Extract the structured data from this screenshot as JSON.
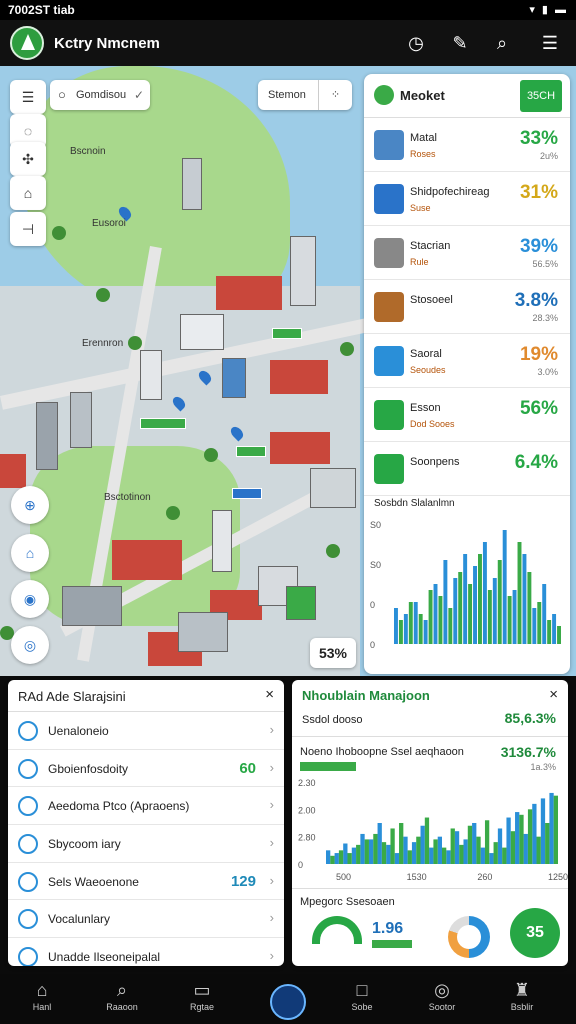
{
  "status_bar": {
    "left": "7002ST tiab",
    "right": "▾ ▮ ▬"
  },
  "app": {
    "title": "Kctry Nmcnem"
  },
  "header_icons": [
    "clock-icon",
    "edit-icon",
    "search-icon",
    "notification-icon"
  ],
  "map": {
    "search_placeholder": "Gomdisou",
    "filter_label": "Stemon",
    "zoom_level": "53%",
    "labels": [
      "Bscnoin",
      "Eusoroi",
      "Erennron",
      "Bsctotinon"
    ]
  },
  "right_panel": {
    "title": "Meoket",
    "badge": "35CH",
    "rows": [
      {
        "name": "Matal",
        "sub": "Roses",
        "percent": "33%",
        "delta": "2u%",
        "color": "#27a745",
        "icon": "#4a86c5"
      },
      {
        "name": "Shidpofechireag",
        "sub": "Suse",
        "percent": "31%",
        "delta": "",
        "color": "#d4a81a",
        "icon": "#2a73c9"
      },
      {
        "name": "Stacrian",
        "sub": "Rule",
        "percent": "39%",
        "delta": "56.5%",
        "color": "#2a8fd8",
        "icon": "#888"
      },
      {
        "name": "Stosoeel",
        "sub": "",
        "percent": "3.8%",
        "delta": "28.3%",
        "color": "#1f6fb8",
        "icon": "#b06a2a"
      },
      {
        "name": "Saoral",
        "sub": "Seoudes",
        "percent": "19%",
        "delta": "3.0%",
        "color": "#e08a2e",
        "icon": "#2a8fd8"
      },
      {
        "name": "Esson",
        "sub": "Dod Sooes",
        "percent": "56%",
        "delta": "",
        "color": "#27a745",
        "icon": "#27a745"
      },
      {
        "name": "Soonpens",
        "sub": "",
        "percent": "6.4%",
        "delta": "",
        "color": "#27a745",
        "icon": "#27a745"
      }
    ],
    "chart_title": "Sosbdn Slalanlmn",
    "chart_y_ticks": [
      "S0",
      "S0",
      "0",
      "0"
    ]
  },
  "left_panel": {
    "title": "RAd Ade Slarajsini",
    "rows": [
      {
        "label": "Uenaloneio",
        "value": "",
        "value_color": "#27a745"
      },
      {
        "label": "Gboienfosdoity",
        "value": "60",
        "value_color": "#27a745"
      },
      {
        "label": "Aeedoma Ptco (Apraoens)",
        "value": "",
        "value_color": "#27a745"
      },
      {
        "label": "Sbycoom iary",
        "value": "",
        "value_color": "#27a745"
      },
      {
        "label": "Sels Waeoenone",
        "value": "129",
        "value_color": "#1f8ab8"
      },
      {
        "label": "Vocalunlary",
        "value": "",
        "value_color": "#27a745"
      },
      {
        "label": "Unadde Ilseoneipalal",
        "value": "",
        "value_color": "#27a745"
      }
    ]
  },
  "metrics_panel": {
    "title": "Nhoublain Manajoon",
    "row1_label": "Ssdol dooso",
    "row1_value": "85,6.3%",
    "row2_label": "Noeno Ihoboopne Ssel aeqhaoon",
    "row2_value": "3136.7%",
    "row2_delta": "1a.3%",
    "y_ticks": [
      "2.30",
      "2.00",
      "2.80",
      "0"
    ],
    "x_ticks": [
      "500",
      "1530",
      "260",
      "1250"
    ],
    "footer_title": "Mpegorc Ssesoaen",
    "footer_value": "1.96",
    "fab_value": "35"
  },
  "chart_data": [
    {
      "type": "bar",
      "title": "Sosbdn Slalanlmn",
      "series": [
        {
          "values": [
            12,
            10,
            14,
            8,
            20,
            28,
            22,
            30,
            26,
            34,
            22,
            38,
            18,
            30,
            12,
            20,
            10
          ]
        },
        {
          "values": [
            8,
            14,
            10,
            18,
            16,
            12,
            24,
            20,
            30,
            18,
            28,
            16,
            34,
            24,
            14,
            8,
            6
          ]
        }
      ],
      "ylim": [
        0,
        40
      ]
    },
    {
      "type": "bar",
      "series": [
        {
          "values": [
            10,
            8,
            15,
            12,
            22,
            18,
            30,
            14,
            8,
            20,
            16,
            28,
            12,
            20,
            10,
            24,
            18,
            30,
            12,
            8,
            26,
            34,
            38,
            22,
            44,
            48,
            52
          ]
        },
        {
          "values": [
            6,
            10,
            8,
            14,
            18,
            22,
            16,
            26,
            30,
            10,
            20,
            34,
            18,
            12,
            26,
            14,
            28,
            20,
            32,
            16,
            12,
            24,
            36,
            40,
            20,
            30,
            50
          ]
        }
      ],
      "ylim": [
        0,
        60
      ]
    }
  ],
  "bottom_nav": [
    {
      "label": "Hanl",
      "icon": "home-icon"
    },
    {
      "label": "Raaoon",
      "icon": "search-icon"
    },
    {
      "label": "Rgtae",
      "icon": "monitor-icon"
    },
    {
      "label": "",
      "icon": "center-icon"
    },
    {
      "label": "Sobe",
      "icon": "square-icon"
    },
    {
      "label": "Sootor",
      "icon": "circle-icon"
    },
    {
      "label": "Bsblir",
      "icon": "bell-icon"
    }
  ]
}
